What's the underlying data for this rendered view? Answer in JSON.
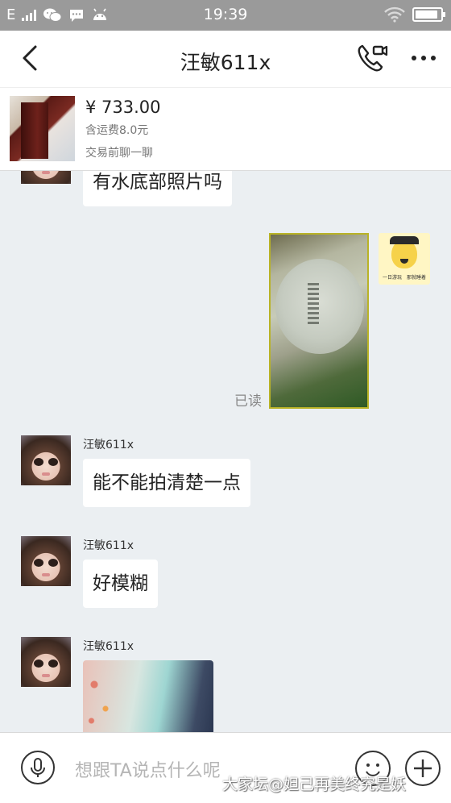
{
  "status_bar": {
    "carrier": "E",
    "time": "19:39",
    "battery_level": 0.9
  },
  "nav": {
    "title": "汪敏611x",
    "icons": [
      "back-arrow",
      "phone-video-call",
      "more-dots"
    ]
  },
  "product": {
    "price": "¥ 733.00",
    "shipping": "含运费8.0元",
    "chat_prompt": "交易前聊一聊"
  },
  "messages": [
    {
      "from": "other",
      "type": "text",
      "text": "有水底部照片吗"
    },
    {
      "from": "self",
      "type": "image",
      "read_status": "已读"
    },
    {
      "from": "other",
      "nickname": "汪敏611x",
      "type": "text",
      "text": "能不能拍清楚一点"
    },
    {
      "from": "other",
      "nickname": "汪敏611x",
      "type": "text",
      "text": "好模糊"
    },
    {
      "from": "other",
      "nickname": "汪敏611x",
      "type": "image"
    }
  ],
  "self_avatar_caption": "一日游玩　那就睡着",
  "input": {
    "placeholder": "想跟TA说点什么呢"
  },
  "watermark": "大家坛@妲己再美终究是妖",
  "colors": {
    "status_bar": "#9a9a9a",
    "chat_bg": "#ebeff2",
    "photo_border": "#b9b327"
  }
}
